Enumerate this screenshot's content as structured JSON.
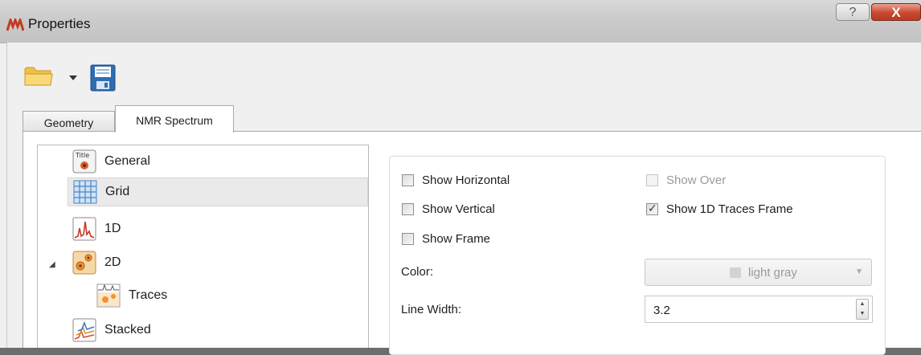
{
  "window": {
    "title": "Properties",
    "help_label": "?",
    "close_label": "X"
  },
  "toolbar": {
    "open_icon": "folder-icon",
    "save_icon": "save-icon"
  },
  "tabs": [
    {
      "label": "Geometry",
      "active": false
    },
    {
      "label": "NMR Spectrum",
      "active": true
    }
  ],
  "tree": {
    "items": [
      {
        "label": "General",
        "icon": "title-icon"
      },
      {
        "label": "Grid",
        "icon": "grid-icon",
        "selected": true
      },
      {
        "label": "1D",
        "icon": "spectrum-1d-icon"
      },
      {
        "label": "2D",
        "icon": "spectrum-2d-icon",
        "expanded": true
      },
      {
        "label": "Traces",
        "icon": "traces-icon"
      },
      {
        "label": "Stacked",
        "icon": "stacked-icon"
      }
    ]
  },
  "grid_settings": {
    "show_horizontal": {
      "label": "Show Horizontal",
      "checked": false
    },
    "show_vertical": {
      "label": "Show Vertical",
      "checked": false
    },
    "show_frame": {
      "label": "Show Frame",
      "checked": false
    },
    "show_over": {
      "label": "Show Over",
      "checked": false,
      "enabled": false
    },
    "show_1d_traces_frame": {
      "label": "Show 1D Traces Frame",
      "checked": true
    },
    "color_label": "Color:",
    "color_value": "light gray",
    "line_width_label": "Line Width:",
    "line_width_value": "3.2"
  }
}
